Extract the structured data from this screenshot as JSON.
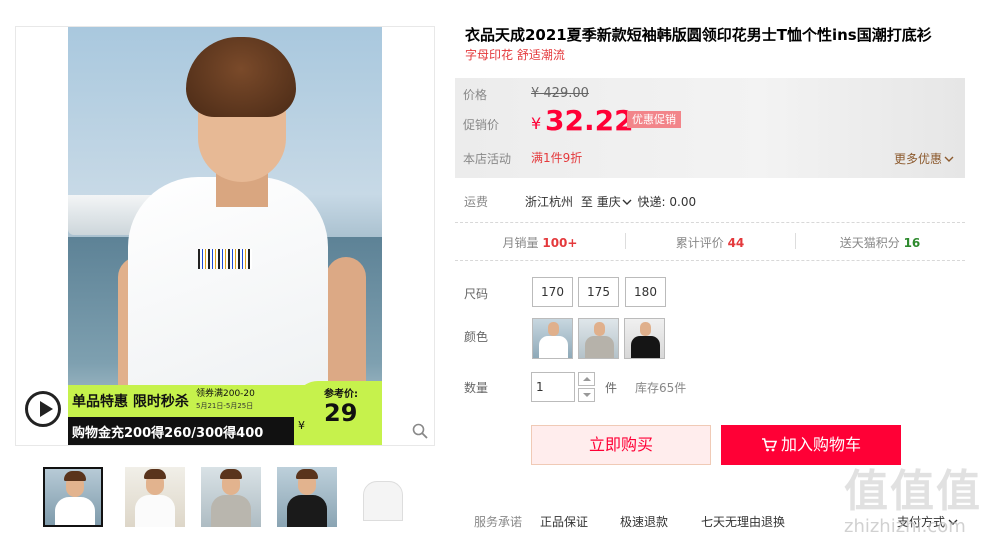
{
  "product": {
    "title": "衣品天成2021夏季新款短袖韩版圆领印花男士T恤个性ins国潮打底衫",
    "subtitle": "字母印花 舒适潮流"
  },
  "image_promo": {
    "title": "单品特惠 限时秒杀",
    "coupon_line1": "领券满200-20",
    "coupon_line2": "5月21日-5月25日",
    "line2": "购物金充200得260/300得400",
    "ref_label": "参考价:",
    "ref_yen": "¥",
    "ref_price": "29"
  },
  "pricing": {
    "price_label": "价格",
    "original_price": "¥ 429.00",
    "promo_label": "促销价",
    "currency": "¥",
    "current_price": "32.22",
    "promo_tag": "优惠促销",
    "activity_label": "本店活动",
    "activity_value": "满1件9折",
    "more_deals": "更多优惠"
  },
  "shipping": {
    "label": "运费",
    "from": "浙江杭州",
    "to_prefix": "至",
    "to": "重庆",
    "fee": "快递: 0.00"
  },
  "stats": {
    "monthly_label": "月销量",
    "monthly_value": "100+",
    "reviews_label": "累计评价",
    "reviews_value": "44",
    "points_label": "送天猫积分",
    "points_value": "16"
  },
  "options": {
    "size_label": "尺码",
    "sizes": [
      "170",
      "175",
      "180"
    ],
    "color_label": "颜色",
    "colors": [
      "white-tee",
      "grey-tee",
      "black-tee"
    ],
    "qty_label": "数量",
    "qty_value": "1",
    "qty_unit": "件",
    "stock": "库存65件"
  },
  "actions": {
    "buy_now": "立即购买",
    "add_to_cart": "加入购物车"
  },
  "service": {
    "label": "服务承诺",
    "items": [
      "正品保证",
      "极速退款",
      "七天无理由退换"
    ],
    "payment": "支付方式"
  },
  "watermark": {
    "glyphs": "值值值",
    "text": "zhizhizhi.com"
  },
  "colors": {
    "accent": "#ff0036",
    "promo_lime": "#c6f24c",
    "tag_pink": "#f2858a"
  }
}
